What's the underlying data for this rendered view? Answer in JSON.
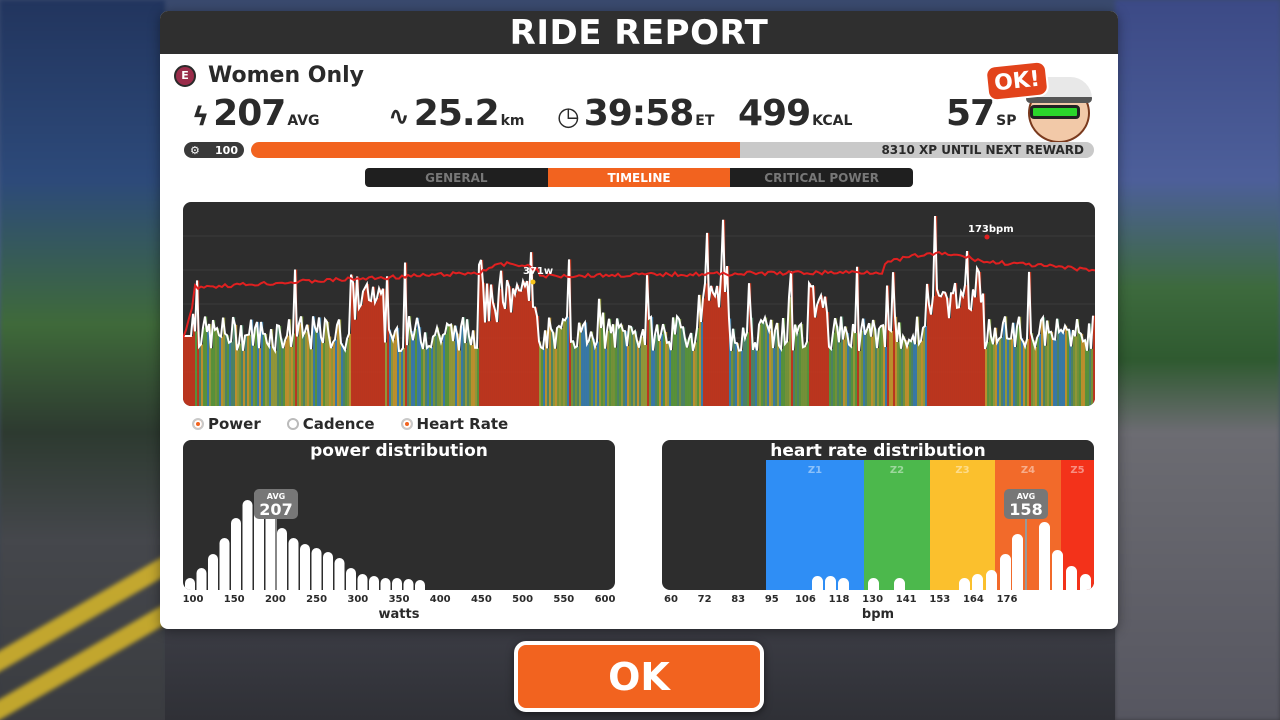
{
  "header": {
    "title": "RIDE REPORT"
  },
  "event": {
    "badge": "E",
    "name": "Women Only"
  },
  "stats": {
    "power": {
      "value": "207",
      "unit": "AVG"
    },
    "distance": {
      "value": "25.2",
      "unit": "km"
    },
    "time": {
      "value": "39:58",
      "unit": "ET"
    },
    "calories": {
      "value": "499",
      "unit": "KCAL"
    },
    "sport_points": {
      "value": "57",
      "unit": "SP"
    }
  },
  "avatar": {
    "bubble": "OK!"
  },
  "xp": {
    "level": "100",
    "progress_fraction": 0.58,
    "text": "8310 XP UNTIL NEXT REWARD"
  },
  "tabs": [
    {
      "label": "GENERAL",
      "active": false
    },
    {
      "label": "TIMELINE",
      "active": true
    },
    {
      "label": "CRITICAL POWER",
      "active": false
    }
  ],
  "timeline": {
    "power_peak_label": "371w",
    "hr_peak_label": "173bpm",
    "colors": {
      "hr_line": "#e02020",
      "power_line": "#ffffff"
    }
  },
  "legend": [
    {
      "label": "Power",
      "on": true
    },
    {
      "label": "Cadence",
      "on": false
    },
    {
      "label": "Heart Rate",
      "on": true
    }
  ],
  "power_distribution": {
    "title": "power distribution",
    "avg_label": "AVG",
    "avg_value": "207",
    "axis_label": "watts",
    "ticks": [
      "100",
      "150",
      "200",
      "250",
      "300",
      "350",
      "400",
      "450",
      "500",
      "550",
      "600"
    ]
  },
  "hr_distribution": {
    "title": "heart rate distribution",
    "avg_label": "AVG",
    "avg_value": "158",
    "axis_label": "bpm",
    "ticks": [
      "60",
      "72",
      "83",
      "95",
      "106",
      "118",
      "130",
      "141",
      "153",
      "164",
      "176"
    ],
    "zones": [
      {
        "label": "Z1",
        "color": "#2f8ef5"
      },
      {
        "label": "Z2",
        "color": "#4cb84c"
      },
      {
        "label": "Z3",
        "color": "#fbc02d"
      },
      {
        "label": "Z4",
        "color": "#f26a2a"
      },
      {
        "label": "Z5",
        "color": "#f3321a"
      }
    ]
  },
  "ok_button": {
    "label": "OK"
  }
}
